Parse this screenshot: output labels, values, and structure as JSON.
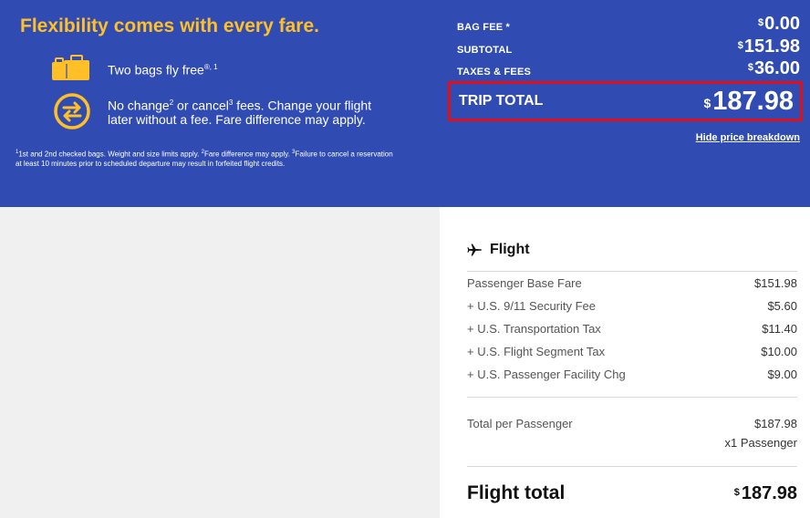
{
  "promo": {
    "title": "Flexibility comes with every fare.",
    "bags_text": "Two bags fly free",
    "bags_sup": "®, 1",
    "change_text_a": "No change",
    "change_sup_a": "2",
    "change_text_b": " or cancel",
    "change_sup_b": "3",
    "change_text_c": " fees. Change your flight later without a fee. Fare difference may apply.",
    "footnote": [
      {
        "sup": "1",
        "text": "1st and 2nd checked bags. Weight and size limits apply. "
      },
      {
        "sup": "2",
        "text": "Fare difference may apply. "
      },
      {
        "sup": "3",
        "text": "Failure to cancel a reservation at least 10 minutes prior to scheduled departure may result in forfeited flight credits."
      }
    ]
  },
  "summary": {
    "currency": "$",
    "bag_fee_label": "BAG FEE *",
    "bag_fee_value": "0.00",
    "subtotal_label": "SUBTOTAL",
    "subtotal_value": "151.98",
    "taxes_label": "TAXES & FEES",
    "taxes_value": "36.00",
    "trip_total_label": "TRIP TOTAL",
    "trip_total_value": "187.98",
    "hide_link": "Hide price breakdown"
  },
  "breakdown": {
    "section_title": "Flight",
    "lines": [
      {
        "label": "Passenger Base Fare",
        "amount": "$151.98"
      },
      {
        "label": "+ U.S. 9/11 Security Fee",
        "amount": "$5.60"
      },
      {
        "label": "+ U.S. Transportation Tax",
        "amount": "$11.40"
      },
      {
        "label": "+ U.S. Flight Segment Tax",
        "amount": "$10.00"
      },
      {
        "label": "+ U.S. Passenger Facility Chg",
        "amount": "$9.00"
      }
    ],
    "per_passenger_label": "Total per Passenger",
    "per_passenger_value": "$187.98",
    "passenger_count": "x1 Passenger",
    "flight_total_label": "Flight total",
    "flight_total_currency": "$",
    "flight_total_value": "187.98"
  },
  "colors": {
    "banner_blue": "#304cb2",
    "accent_yellow": "#ffbf27",
    "highlight_red": "#e0101b"
  }
}
